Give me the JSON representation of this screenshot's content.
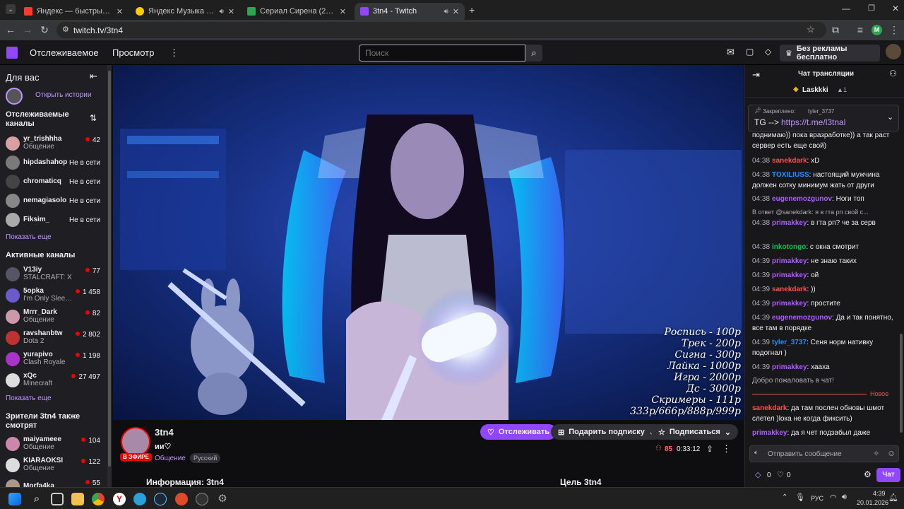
{
  "browser": {
    "tabs": [
      {
        "title": "Яндекс — быстрый поиск в и",
        "color": "#ff3b30"
      },
      {
        "title": "Яндекс Музыка — собира",
        "color": "#ffcc00"
      },
      {
        "title": "Сериал Сирена (2018) Смотре",
        "color": "#2da44e"
      },
      {
        "title": "3tn4 - Twitch",
        "color": "#9147ff"
      }
    ],
    "url": "twitch.tv/3tn4",
    "profile_initial": "M"
  },
  "topnav": {
    "following": "Отслеживаемое",
    "browse": "Просмотр",
    "search_placeholder": "Поиск",
    "no_ads": "Без рекламы бесплатно"
  },
  "sidebar": {
    "for_you": "Для вас",
    "open_stories": "Открыть истории",
    "followed_heading": "Отслеживаемые каналы",
    "followed": [
      {
        "name": "yr_trishhha",
        "category": "Общение",
        "viewers": "42",
        "color": "#d8a0a0"
      },
      {
        "name": "hipdashahop",
        "status": "Не в сети",
        "color": "#7a7a7a"
      },
      {
        "name": "chromaticq",
        "status": "Не в сети",
        "color": "#444"
      },
      {
        "name": "nemagiasolo",
        "status": "Не в сети",
        "color": "#888"
      },
      {
        "name": "Fiksim_",
        "status": "Не в сети",
        "color": "#aaa"
      }
    ],
    "show_more": "Показать еще",
    "active_heading": "Активные каналы",
    "active": [
      {
        "name": "V13iy",
        "category": "STALCRAFT: X",
        "viewers": "77",
        "color": "#556"
      },
      {
        "name": "5opka",
        "category": "I'm Only Sleep...",
        "viewers": "1 458",
        "color": "#6a5acd"
      },
      {
        "name": "Mrrr_Dark",
        "category": "Общение",
        "viewers": "82",
        "color": "#c9a"
      },
      {
        "name": "ravshanbtw",
        "category": "Dota 2",
        "viewers": "2 802",
        "color": "#b33"
      },
      {
        "name": "yurapivo",
        "category": "Clash Royale",
        "viewers": "1 198",
        "color": "#a3c"
      },
      {
        "name": "xQc",
        "category": "Minecraft",
        "viewers": "27 497",
        "color": "#ddd"
      }
    ],
    "show_more_2": "Показать еще",
    "also_watch_heading": "Зрители 3tn4 также смотрят",
    "also_watch": [
      {
        "name": "maiyameee",
        "category": "Общение",
        "viewers": "104",
        "color": "#c8a"
      },
      {
        "name": "KIARAOKSI",
        "category": "Общение",
        "viewers": "122",
        "color": "#ddd"
      },
      {
        "name": "Morfa4ka",
        "category": "",
        "viewers": "55",
        "color": "#a98"
      }
    ]
  },
  "video": {
    "overlay_prices": [
      "Роспись - 100р",
      "Трек - 200р",
      "Сигна - 300р",
      "Лайка - 1000р",
      "Игра - 2000р",
      "Дс - 3000р",
      "Скримеры - 111р",
      "333р/666р/888р/999р"
    ]
  },
  "stream_info": {
    "channel": "3tn4",
    "title": "ии♡",
    "live": "В ЭФИРЕ",
    "category": "Общение",
    "tag": "Русский",
    "follow": "Отслеживать",
    "gift_sub": "Подарить подписку",
    "subscribe": "Подписаться",
    "viewers": "85",
    "uptime": "0:33:12",
    "about": "Информация: 3tn4",
    "goal": "Цель 3tn4"
  },
  "chat": {
    "header": "Чат трансляции",
    "top_user": "Laskkki",
    "top_count": "1",
    "pinned_label": "Закреплено:",
    "pinned_by": "tyler_3737",
    "pinned_prefix": "TG -->",
    "pinned_link": "https://t.me/l3tnal",
    "partial_line": "поднимаю)) пока вразработке)) а так раст сервер есть еще свой)",
    "messages": [
      {
        "time": "04:38",
        "user": "sanekdark",
        "color": "#ff4f4f",
        "text": "xD"
      },
      {
        "time": "04:38",
        "user": "TOXILIUSS",
        "color": "#1e90ff",
        "text": "настоящий мужчина должен сотку минимум жать от други"
      },
      {
        "time": "04:38",
        "user": "eugenemozgunov",
        "color": "#b05cff",
        "text": "Ноги топ"
      },
      {
        "time": "",
        "user": "",
        "color": "#adadb8",
        "text": "В ответ @sanekdark: я в гта рп свой с..."
      },
      {
        "time": "04:38",
        "user": "primakkey",
        "color": "#b05cff",
        "text": "в гта рп? че за серв"
      },
      {
        "time": "04:38",
        "user": "inkotongo",
        "color": "#00c853",
        "text": "с окна смотрит"
      },
      {
        "time": "04:39",
        "user": "primakkey",
        "color": "#b05cff",
        "text": "не знаю таких"
      },
      {
        "time": "04:39",
        "user": "primakkey",
        "color": "#b05cff",
        "text": "ой"
      },
      {
        "time": "04:39",
        "user": "sanekdark",
        "color": "#ff4f4f",
        "text": "))"
      },
      {
        "time": "04:39",
        "user": "primakkey",
        "color": "#b05cff",
        "text": "простите"
      },
      {
        "time": "04:39",
        "user": "eugenemozgunov",
        "color": "#b05cff",
        "text": "Да и так понятно, все там в порядке"
      },
      {
        "time": "04:39",
        "user": "tyler_3737",
        "color": "#1e90ff",
        "text": "Сеня норм нативку подогнал )"
      },
      {
        "time": "04:39",
        "user": "primakkey",
        "color": "#b05cff",
        "text": "хааха"
      }
    ],
    "welcome": "Добро пожаловать в чат!",
    "new_label": "Новое",
    "new_messages": [
      {
        "user": "sanekdark",
        "color": "#ff4f4f",
        "text": "да там послен обновы шмот слетел )loка не когда фиксить)"
      },
      {
        "user": "primakkey",
        "color": "#b05cff",
        "text": "да я чет подзабыл даже"
      }
    ],
    "input_placeholder": "Отправить сообщение",
    "points_a": "0",
    "points_b": "0",
    "chat_button": "Чат"
  },
  "taskbar": {
    "lang": "РУС",
    "time": "4:39",
    "date": "20.01.2026"
  }
}
